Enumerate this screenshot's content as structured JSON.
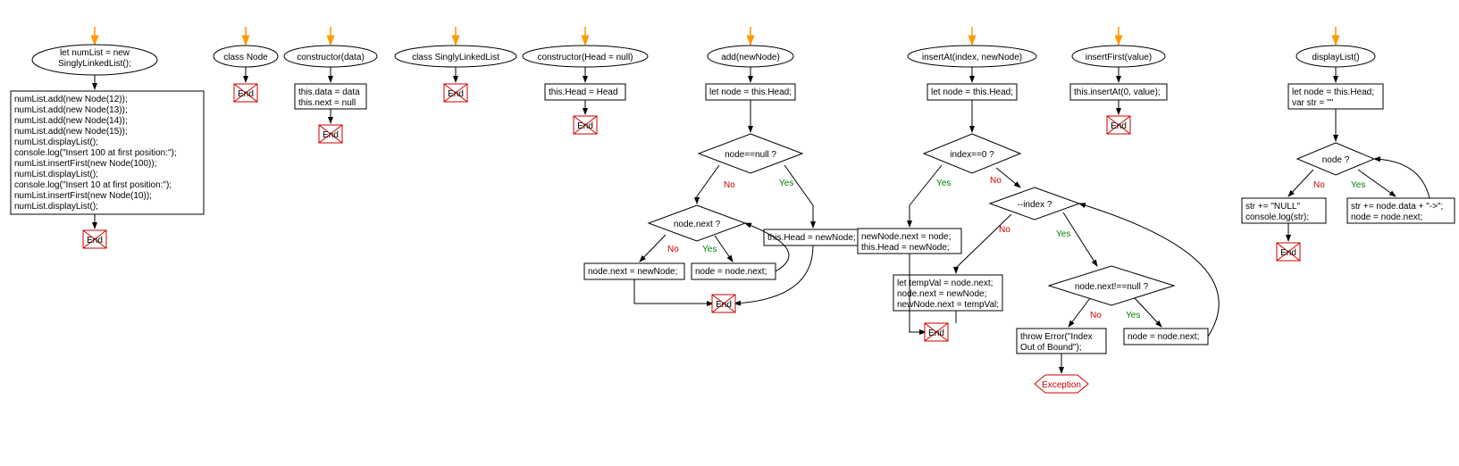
{
  "flow1": {
    "start": "let numList = new\nSinglyLinkedList();",
    "code": "numList.add(new Node(12));\nnumList.add(new Node(13));\nnumList.add(new Node(14));\nnumList.add(new Node(15));\nnumList.displayList();\nconsole.log(\"Insert 100 at first position:\");\nnumList.insertFirst(new Node(100));\nnumList.displayList();\nconsole.log(\"Insert 10 at first position:\");\nnumList.insertFirst(new Node(10));\nnumList.displayList();",
    "end": "End"
  },
  "flow2": {
    "start": "class Node",
    "end": "End"
  },
  "flow3": {
    "start": "constructor(data)",
    "code": "this.data = data\nthis.next = null",
    "end": "End"
  },
  "flow4": {
    "start": "class SinglyLinkedList",
    "end": "End"
  },
  "flow5": {
    "start": "constructor(Head = null)",
    "code": "this.Head = Head",
    "end": "End"
  },
  "flow6": {
    "start": "add(newNode)",
    "box1": "let node = this.Head;",
    "cond1": "node==null ?",
    "cond2": "node.next ?",
    "box2": "this.Head = newNode;",
    "box3": "node.next = newNode;",
    "box4": "node = node.next;",
    "end": "End",
    "yes": "Yes",
    "no": "No"
  },
  "flow7": {
    "start": "insertAt(index, newNode)",
    "box1": "let node = this.Head;",
    "cond1": "index==0 ?",
    "box2": "newNode.next = node;\nthis.Head = newNode;",
    "cond2": "--index ?",
    "cond3": "node.next!==null ?",
    "box3": "let tempVal = node.next;\nnode.next = newNode;\nnewNode.next = tempVal;",
    "box4": "throw Error(\"Index\nOut of Bound\");",
    "box5": "node = node.next;",
    "exception": "Exception",
    "end": "End",
    "yes": "Yes",
    "no": "No"
  },
  "flow8": {
    "start": "insertFirst(value)",
    "code": "this.insertAt(0, value);",
    "end": "End"
  },
  "flow9": {
    "start": "displayList()",
    "box1": "let node = this.Head;\nvar str = \"\"",
    "cond1": "node ?",
    "box2": "str += \"NULL\"\nconsole.log(str);",
    "box3": "str += node.data + \"->\";\nnode = node.next;",
    "end": "End",
    "yes": "Yes",
    "no": "No"
  }
}
